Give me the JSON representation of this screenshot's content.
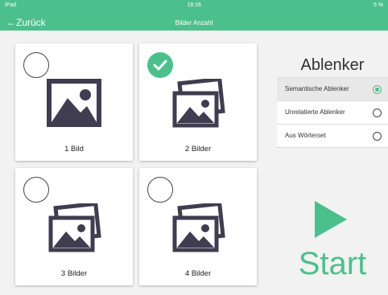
{
  "status_bar": {
    "left": "iPad",
    "time": "19:16",
    "right": "5 %"
  },
  "nav": {
    "back_label": "←Zurück",
    "title": "Bilder Anzahl"
  },
  "cards": [
    {
      "label": "1 Bild",
      "checked": false,
      "icon": "single-image-icon"
    },
    {
      "label": "2 Bilder",
      "checked": true,
      "icon": "multiple-images-icon"
    },
    {
      "label": "3 Bilder",
      "checked": false,
      "icon": "multiple-images-icon"
    },
    {
      "label": "4 Bilder",
      "checked": false,
      "icon": "multiple-images-icon"
    }
  ],
  "distractors": {
    "title": "Ablenker",
    "options": [
      {
        "label": "Semantische Ablenker",
        "selected": true
      },
      {
        "label": "Unrelatierte Ablenker",
        "selected": false
      },
      {
        "label": "Aus Wörterset",
        "selected": false
      }
    ]
  },
  "start": {
    "label": "Start",
    "icon": "play-icon"
  },
  "colors": {
    "accent": "#4cc08c",
    "icon_dark": "#3f3d4f"
  }
}
